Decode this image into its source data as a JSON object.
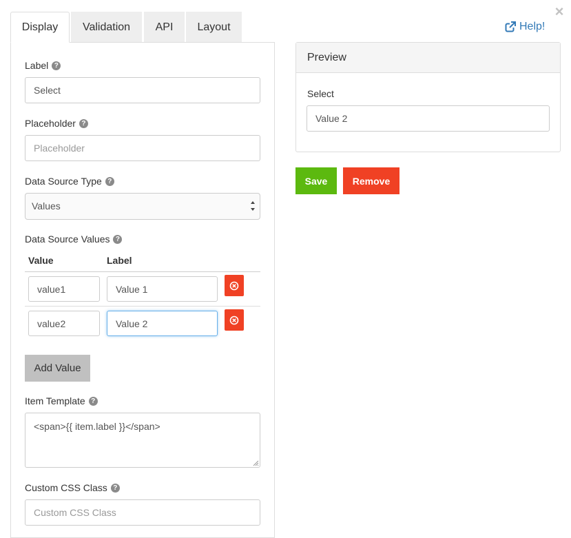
{
  "window": {
    "close_glyph": "×"
  },
  "tabs": [
    {
      "label": "Display",
      "active": true
    },
    {
      "label": "Validation",
      "active": false
    },
    {
      "label": "API",
      "active": false
    },
    {
      "label": "Layout",
      "active": false
    }
  ],
  "help": {
    "label": "Help!",
    "icon": "external-link-icon"
  },
  "form": {
    "label": {
      "title": "Label",
      "value": "Select"
    },
    "placeholder": {
      "title": "Placeholder",
      "placeholder": "Placeholder"
    },
    "data_source_type": {
      "title": "Data Source Type",
      "selected": "Values"
    },
    "data_source_values": {
      "title": "Data Source Values",
      "columns": [
        "Value",
        "Label"
      ],
      "rows": [
        {
          "value": "value1",
          "label": "Value 1"
        },
        {
          "value": "value2",
          "label": "Value 2"
        }
      ],
      "add_label": "Add Value"
    },
    "item_template": {
      "title": "Item Template",
      "value": "<span>{{ item.label }}</span>"
    },
    "custom_css_class": {
      "title": "Custom CSS Class",
      "placeholder": "Custom CSS Class"
    }
  },
  "preview": {
    "title": "Preview",
    "field_label": "Select",
    "selected_value": "Value 2"
  },
  "actions": {
    "save_label": "Save",
    "remove_label": "Remove"
  },
  "colors": {
    "link": "#337ab7",
    "save": "#5cb90f",
    "danger": "#f04124",
    "focus": "#66afe9"
  }
}
